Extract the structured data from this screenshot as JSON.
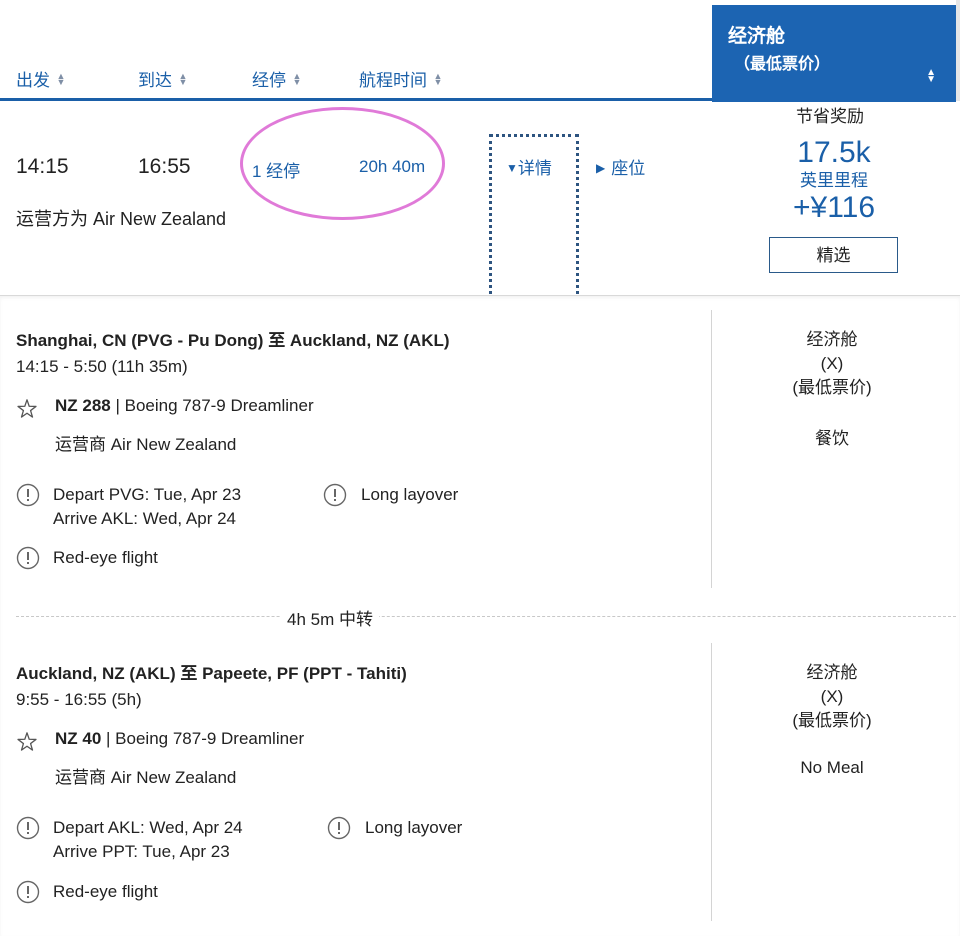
{
  "header": {
    "columns": {
      "depart": "出发",
      "arrive": "到达",
      "stops": "经停",
      "duration": "航程时间"
    },
    "fare_tab": {
      "title": "经济舱",
      "subtitle": "（最低票价）"
    }
  },
  "summary": {
    "depart_time": "14:15",
    "arrive_time": "16:55",
    "stops": "1 经停",
    "duration": "20h 40m",
    "operator": "运营方为 Air New Zealand",
    "details_label": "详情",
    "seats_label": "座位",
    "reward": {
      "label": "节省奖励",
      "miles": "17.5k",
      "miles_unit": "英里里程",
      "tax": "+¥116",
      "select_label": "精选"
    }
  },
  "segments": [
    {
      "route_from": "Shanghai, CN (PVG - Pu Dong)",
      "route_to": "Auckland, NZ (AKL)",
      "route_joiner": "至",
      "times": "14:15 - 5:50 (11h 35m)",
      "flight_number": "NZ 288",
      "aircraft": "Boeing 787-9 Dreamliner",
      "operator": "运营商 Air New Zealand",
      "alerts": {
        "depart": "Depart PVG: Tue, Apr 23",
        "arrive": "Arrive AKL: Wed, Apr 24",
        "layover": "Long layover",
        "redeye": "Red-eye flight"
      },
      "cabin": {
        "name": "经济舱",
        "code": "(X)",
        "fare": "(最低票价)",
        "meal": "餐饮"
      }
    },
    {
      "route_from": "Auckland, NZ (AKL)",
      "route_to": "Papeete, PF (PPT - Tahiti)",
      "route_joiner": "至",
      "times": "9:55 - 16:55 (5h)",
      "flight_number": "NZ 40",
      "aircraft": "Boeing 787-9 Dreamliner",
      "operator": "运营商 Air New Zealand",
      "alerts": {
        "depart": "Depart AKL: Wed, Apr 24",
        "arrive": "Arrive PPT: Tue, Apr 23",
        "layover": "Long layover",
        "redeye": "Red-eye flight"
      },
      "cabin": {
        "name": "经济舱",
        "code": "(X)",
        "fare": "(最低票价)",
        "meal": "No Meal"
      }
    }
  ],
  "connection": {
    "text": "4h 5m 中转"
  },
  "colors": {
    "brand_blue": "#1c64b2",
    "link_blue": "#1a5fa8",
    "highlight_magenta": "#e07ad8"
  }
}
